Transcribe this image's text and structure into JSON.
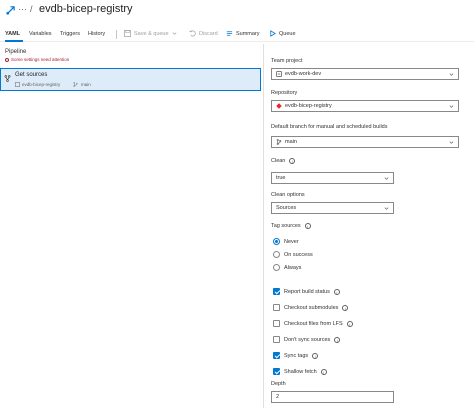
{
  "header": {
    "more_label": "···",
    "separator": "/",
    "title": "evdb-bicep-registry"
  },
  "toolbar": {
    "tabs": [
      {
        "label": "YAML"
      },
      {
        "label": "Variables"
      },
      {
        "label": "Triggers"
      },
      {
        "label": "History"
      }
    ],
    "save_queue_label": "Save & queue",
    "discard_label": "Discard",
    "summary_label": "Summary",
    "queue_label": "Queue"
  },
  "left": {
    "pipeline_title": "Pipeline",
    "pipeline_warning": "Some settings need attention",
    "sources_title": "Get sources",
    "sources_repo": "evdb-bicep-registry",
    "sources_branch": "main"
  },
  "right": {
    "team_project_label": "Team project",
    "team_project_value": "evdb-work-dev",
    "repository_label": "Repository",
    "repository_value": "evdb-bicep-registry",
    "branch_label": "Default branch for manual and scheduled builds",
    "branch_value": "main",
    "clean_label": "Clean",
    "clean_value": "true",
    "clean_options_label": "Clean options",
    "clean_options_value": "Sources",
    "tag_sources_label": "Tag sources",
    "tag_options": [
      {
        "label": "Never",
        "selected": true
      },
      {
        "label": "On success",
        "selected": false
      },
      {
        "label": "Always",
        "selected": false
      }
    ],
    "checkboxes": [
      {
        "label": "Report build status",
        "checked": true
      },
      {
        "label": "Checkout submodules",
        "checked": false
      },
      {
        "label": "Checkout files from LFS",
        "checked": false
      },
      {
        "label": "Don't sync sources",
        "checked": false
      },
      {
        "label": "Sync tags",
        "checked": true
      },
      {
        "label": "Shallow fetch",
        "checked": true
      }
    ],
    "depth_label": "Depth",
    "depth_value": "2"
  },
  "colors": {
    "accent": "#0078d4",
    "selected_bg": "#deecf9",
    "error": "#a4262c",
    "repo_icon": "#e8262c"
  }
}
